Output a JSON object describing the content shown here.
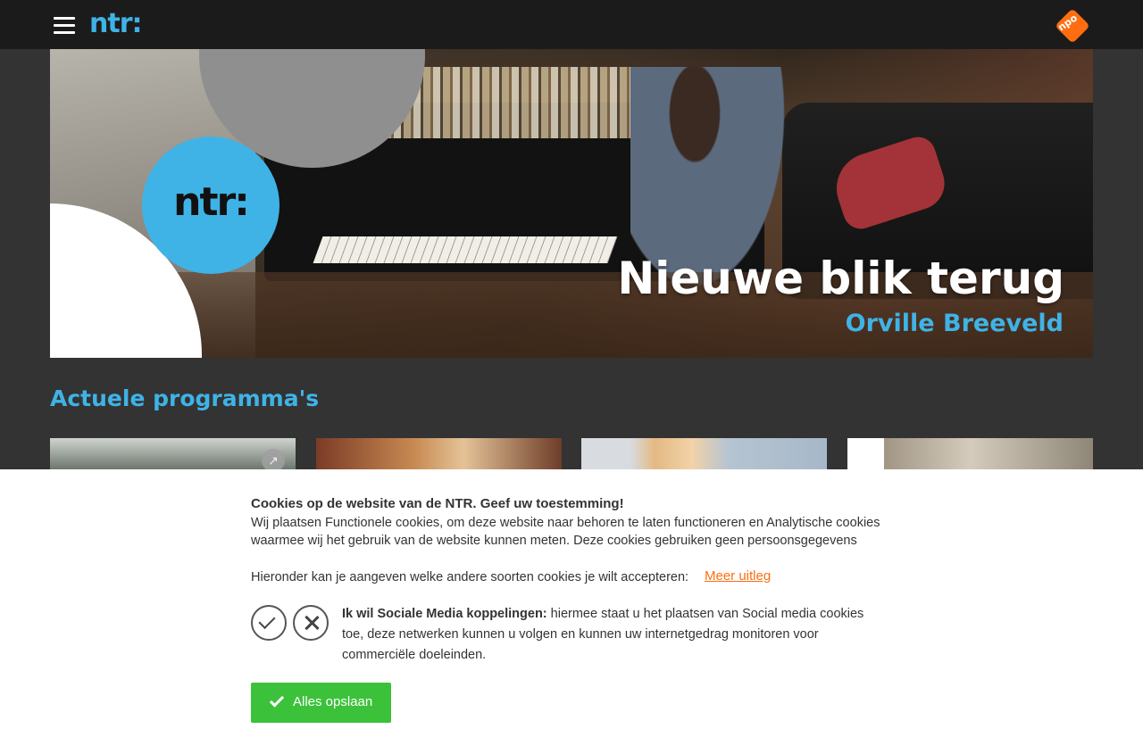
{
  "header": {
    "logo_text": "ntr:",
    "npo_logo_text": "npo"
  },
  "hero": {
    "logo_text": "ntr:",
    "title": "Nieuwe blik terug",
    "subtitle": "Orville Breeveld"
  },
  "section": {
    "title": "Actuele programma's"
  },
  "cards": [
    {
      "icon": "external-link-icon"
    },
    {},
    {},
    {}
  ],
  "cookie_banner": {
    "title": "Cookies op de website van de NTR. Geef uw toestemming!",
    "text": "Wij plaatsen Functionele cookies, om deze website naar behoren te laten functioneren en Analytische cookies waarmee wij het gebruik van de website kunnen meten. Deze cookies gebruiken geen persoonsgegevens",
    "below_text": "Hieronder kan je aangeven welke andere soorten cookies je wilt accepteren:",
    "more_link": "Meer uitleg",
    "social_label": "Ik wil Sociale Media koppelingen:",
    "social_text": " hiermee staat u het plaatsen van Social media cookies toe, deze netwerken kunnen u volgen en kunnen uw internetgedrag monitoren voor commerciële doeleinden.",
    "save_button": "Alles opslaan"
  },
  "colors": {
    "brand_blue": "#3fb3e6",
    "npo_orange": "#ff6d10",
    "save_green": "#3cc13b"
  }
}
